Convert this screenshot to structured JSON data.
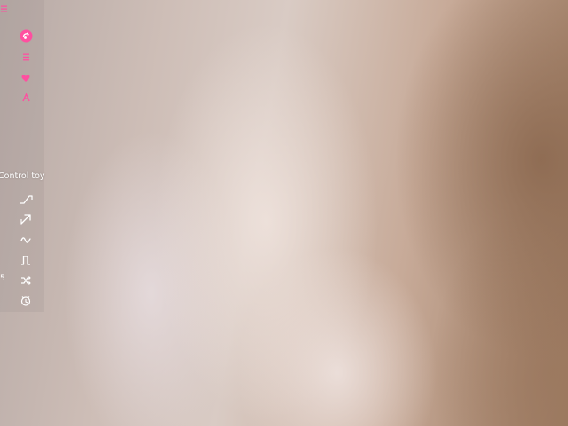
{
  "colors": {
    "accent": "#ff4fa0",
    "panel_text": "#ffffff"
  },
  "sidebar": {
    "top_icons": [
      {
        "icon": "menu-icon"
      },
      {
        "icon": "lush-toy-icon"
      },
      {
        "icon": "list-icon"
      },
      {
        "icon": "heart-icon"
      },
      {
        "icon": "pattern-icon"
      }
    ],
    "control_label": "Control toy",
    "control_icons": [
      {
        "icon": "ramp-icon"
      },
      {
        "icon": "rise-icon"
      },
      {
        "icon": "wave-icon"
      },
      {
        "icon": "pulse-icon"
      },
      {
        "icon": "random-icon"
      },
      {
        "icon": "earthquake-icon"
      }
    ],
    "side_number": "5"
  }
}
